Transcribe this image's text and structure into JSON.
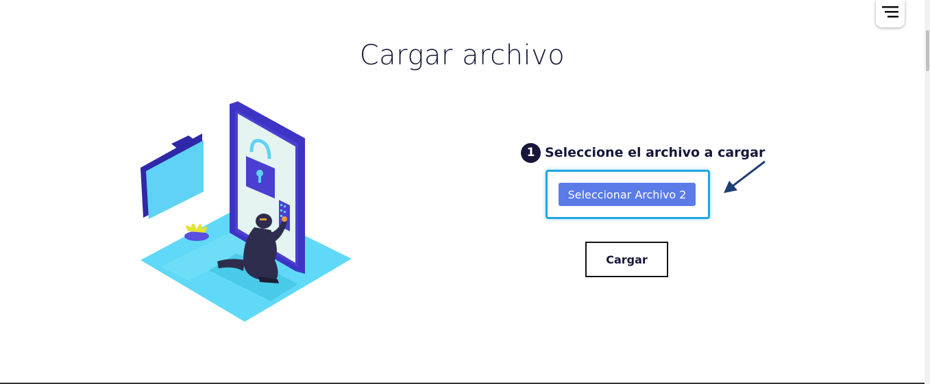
{
  "page": {
    "title": "Cargar archivo"
  },
  "menu": {
    "icon": "hamburger-menu-icon"
  },
  "illustration": {
    "icons": [
      "folder-icon",
      "tablet-icon",
      "padlock-icon",
      "keypad-icon",
      "plant-icon",
      "thief-figure"
    ]
  },
  "upload_form": {
    "step_number": "1",
    "step_text": "Seleccione el archivo a cargar",
    "select_button_label": "Seleccionar Archivo 2",
    "upload_button_label": "Cargar"
  },
  "annotation": {
    "arrow_icon": "pointer-arrow-icon",
    "highlight_color": "#1fa7e0"
  },
  "colors": {
    "primary_button": "#5a7be8",
    "title_text": "#16163a",
    "illustration_floor": "#5fd9f7",
    "illustration_purple": "#4b3fd1"
  }
}
